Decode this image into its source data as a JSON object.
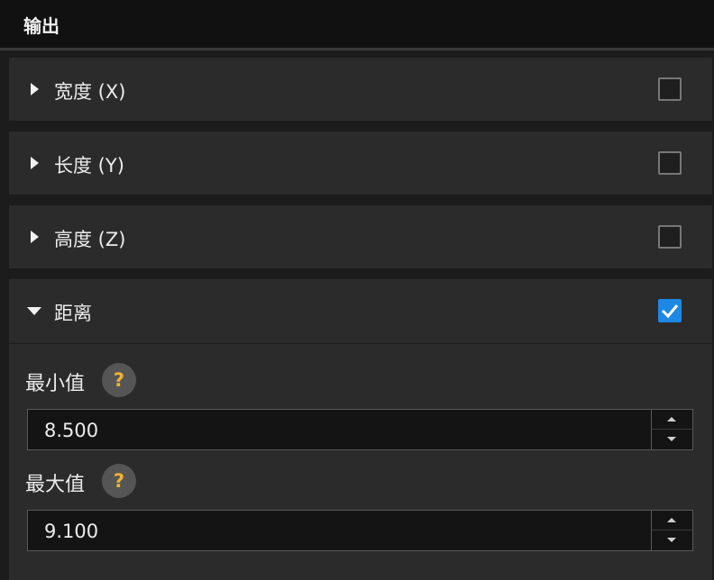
{
  "header": {
    "title": "输出"
  },
  "sections": [
    {
      "label": "宽度 (X)",
      "expanded": false,
      "checked": false
    },
    {
      "label": "长度 (Y)",
      "expanded": false,
      "checked": false
    },
    {
      "label": "高度 (Z)",
      "expanded": false,
      "checked": false
    },
    {
      "label": "距离",
      "expanded": true,
      "checked": true
    }
  ],
  "distance": {
    "min": {
      "label": "最小值",
      "help": "?",
      "value": "8.500"
    },
    "max": {
      "label": "最大值",
      "help": "?",
      "value": "9.100"
    }
  },
  "colors": {
    "accent": "#1e88e5",
    "help_icon": "#f2b233",
    "panel_bg": "#2b2b2b",
    "header_bg": "#111111"
  }
}
